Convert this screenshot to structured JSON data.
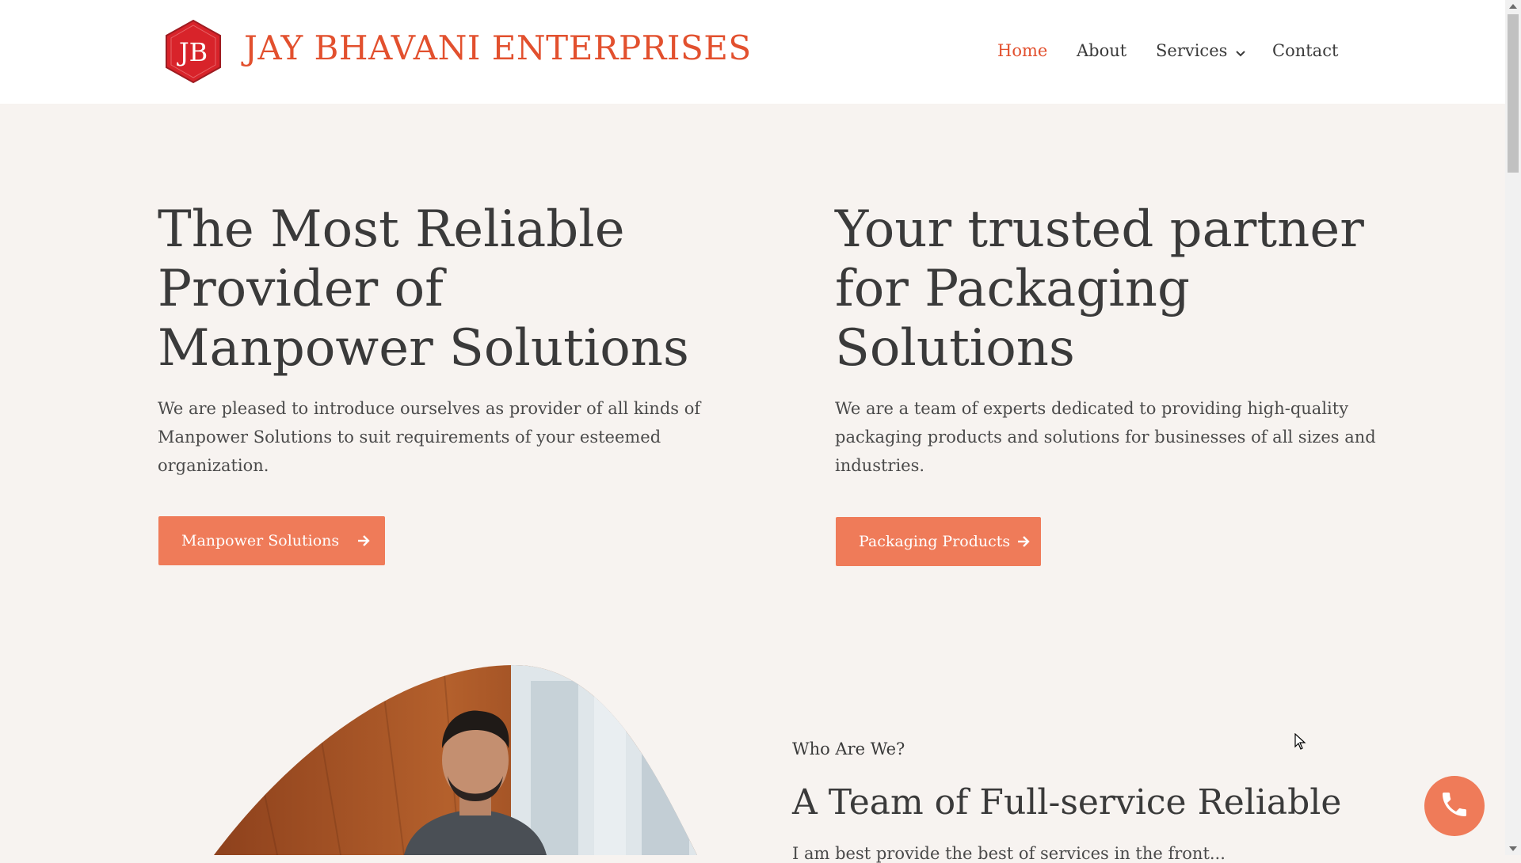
{
  "header": {
    "logo_text": "JB",
    "brand": "JAY BHAVANI ENTERPRISES",
    "nav": [
      {
        "label": "Home",
        "active": true
      },
      {
        "label": "About"
      },
      {
        "label": "Services",
        "has_dropdown": true
      },
      {
        "label": "Contact"
      }
    ]
  },
  "hero": {
    "left": {
      "title_lines": [
        "The Most Reliable",
        "Provider of",
        "Manpower Solutions"
      ],
      "text_lines": [
        "We are pleased to introduce ourselves as provider of all kinds of",
        "Manpower Solutions to suit requirements of your esteemed",
        "organization."
      ],
      "button_label": "Manpower Solutions"
    },
    "right": {
      "title_lines": [
        "Your trusted partner",
        "for Packaging",
        "Solutions"
      ],
      "text_lines": [
        "We are a team of experts dedicated to providing high-quality",
        "packaging products and solutions for businesses of all sizes and",
        "industries."
      ],
      "button_label": "Packaging Products"
    }
  },
  "about": {
    "eyebrow": "Who Are We?",
    "title": "A Team of Full-service Reliable",
    "text_partial": "I am best provide the best of services in the front..."
  },
  "icons": {
    "call": "phone-icon",
    "arrow": "arrow-right-icon",
    "dropdown": "chevron-down-icon"
  },
  "colors": {
    "accent": "#e2502e",
    "button": "#ef7b59",
    "background": "#f7f3f0",
    "text": "#3a3a3a"
  }
}
